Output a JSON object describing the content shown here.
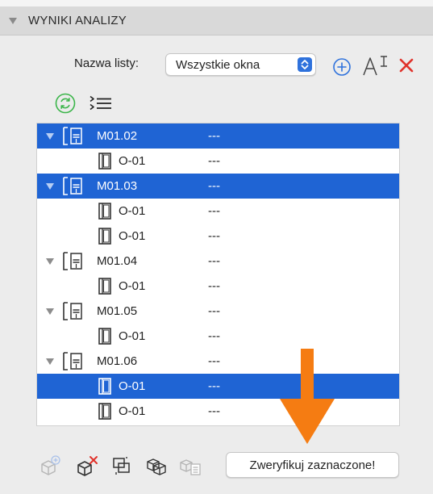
{
  "panel": {
    "title": "WYNIKI ANALIZY"
  },
  "list_selector": {
    "label": "Nazwa listy:",
    "value": "Wszystkie okna"
  },
  "toolbar": {
    "add_icon": "plus-circle-icon",
    "rename_icon": "text-cursor-icon",
    "delete_icon": "close-icon",
    "refresh_icon": "refresh-icon",
    "list_icon": "collapse-list-icon"
  },
  "tree": {
    "rows": [
      {
        "type": "room",
        "name": "M01.02",
        "value": "---",
        "selected": true
      },
      {
        "type": "window",
        "name": "O-01",
        "value": "---",
        "selected": false
      },
      {
        "type": "room",
        "name": "M01.03",
        "value": "---",
        "selected": true
      },
      {
        "type": "window",
        "name": "O-01",
        "value": "---",
        "selected": false
      },
      {
        "type": "window",
        "name": "O-01",
        "value": "---",
        "selected": false
      },
      {
        "type": "room",
        "name": "M01.04",
        "value": "---",
        "selected": false
      },
      {
        "type": "window",
        "name": "O-01",
        "value": "---",
        "selected": false
      },
      {
        "type": "room",
        "name": "M01.05",
        "value": "---",
        "selected": false
      },
      {
        "type": "window",
        "name": "O-01",
        "value": "---",
        "selected": false
      },
      {
        "type": "room",
        "name": "M01.06",
        "value": "---",
        "selected": false
      },
      {
        "type": "window",
        "name": "O-01",
        "value": "---",
        "selected": true
      },
      {
        "type": "window",
        "name": "O-01",
        "value": "---",
        "selected": false
      }
    ]
  },
  "bottom_toolbar": {
    "icons": [
      "add-object-icon",
      "remove-object-icon",
      "zone-icon",
      "select-objects-icon",
      "list-objects-icon"
    ],
    "verify_label": "Zweryfikuj zaznaczone!"
  },
  "colors": {
    "selection": "#1f64d4",
    "accent": "#2f72dc",
    "delete": "#e0322b",
    "refresh": "#3bb54a",
    "annotation_arrow": "#f57c12"
  }
}
